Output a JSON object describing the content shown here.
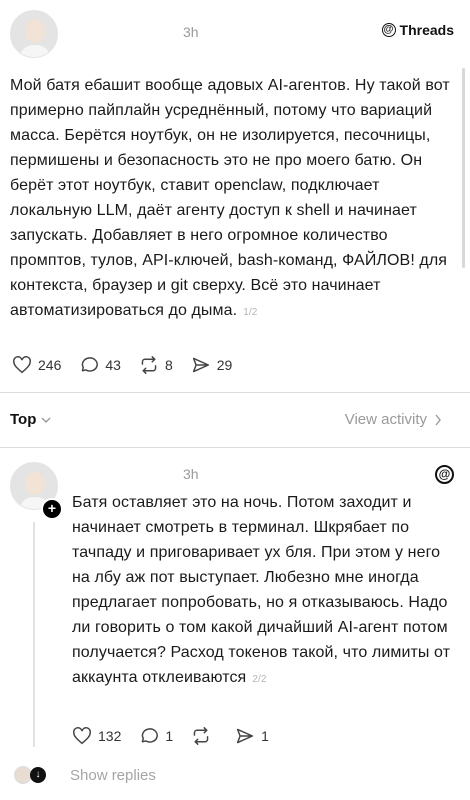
{
  "post": {
    "time": "3h",
    "brand": "Threads",
    "text": "Мой батя ебашит вообще адовых AI-агентов. Ну такой вот примерно пайплайн усреднённый, потому что вариаций масса. Берётся ноутбук, он не изолируется, песочницы, пермишены и безопасность это не про моего батю. Он берёт этот ноутбук, ставит openclaw, подключает локальную LLM, даёт агенту доступ к shell и начинает запускать. Добавляет в него огромное количество промптов, тулов, API-ключей, bash-команд, ФАЙЛОВ! для контекста, браузер и git сверху. Всё это начинает автоматизироваться до дыма.",
    "page": "1/2",
    "likes": "246",
    "comments": "43",
    "reposts": "8",
    "shares": "29"
  },
  "sort": {
    "label": "Top",
    "view_activity": "View activity"
  },
  "reply": {
    "time": "3h",
    "text": "Батя оставляет это на ночь. Потом заходит и начинает смотреть в терминал. Шкрябает по тачпаду и приговаривает ух бля. При этом у него на лбу аж пот выступает. Любезно мне иногда предлагает попробовать, но я отказываюсь. Надо ли говорить о том какой дичайший AI-агент потом получается? Расход токенов такой, что лимиты от аккаунта отклеиваются",
    "page": "2/2",
    "likes": "132",
    "comments": "1",
    "reposts": "",
    "shares": "1"
  },
  "show_replies": "Show replies"
}
